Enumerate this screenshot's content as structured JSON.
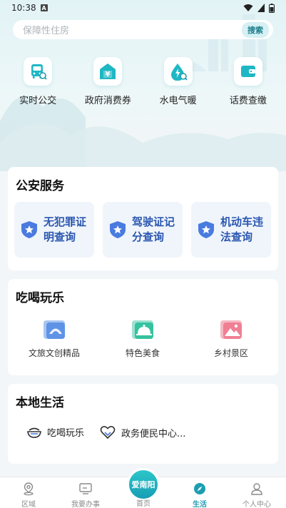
{
  "status_bar": {
    "time": "10:38",
    "notif_icon": "A"
  },
  "search": {
    "placeholder": "保障性住房",
    "button": "搜索"
  },
  "quick_services": [
    {
      "label": "实时公交",
      "icon": "bus-icon"
    },
    {
      "label": "政府消费券",
      "icon": "coupon-icon"
    },
    {
      "label": "水电气暖",
      "icon": "utility-icon"
    },
    {
      "label": "话费查缴",
      "icon": "wallet-icon"
    }
  ],
  "police": {
    "title": "公安服务",
    "items": [
      {
        "label": "无犯罪证明查询",
        "icon": "shield-star-icon"
      },
      {
        "label": "驾驶证记分查询",
        "icon": "shield-star-icon"
      },
      {
        "label": "机动车违法查询",
        "icon": "shield-star-icon"
      }
    ]
  },
  "fun": {
    "title": "吃喝玩乐",
    "items": [
      {
        "label": "文旅文创精品",
        "icon": "fan-icon"
      },
      {
        "label": "特色美食",
        "icon": "cloche-icon"
      },
      {
        "label": "乡村景区",
        "icon": "landscape-icon"
      }
    ]
  },
  "local": {
    "title": "本地生活",
    "items": [
      {
        "label": "吃喝玩乐",
        "icon": "bowl-icon"
      },
      {
        "label": "政务便民中心...",
        "icon": "heart-hands-icon"
      }
    ]
  },
  "tabbar": {
    "tabs": [
      {
        "label": "区域",
        "icon": "location-icon"
      },
      {
        "label": "我要办事",
        "icon": "monitor-icon"
      },
      {
        "label": "生活",
        "icon": "compass-icon",
        "active": true
      },
      {
        "label": "个人中心",
        "icon": "person-icon"
      }
    ],
    "home_badge": "爱南阳",
    "home_label": "首页"
  },
  "colors": {
    "accent": "#1d9db0",
    "police_text": "#2b57b0",
    "shield": "#4a7be0"
  }
}
